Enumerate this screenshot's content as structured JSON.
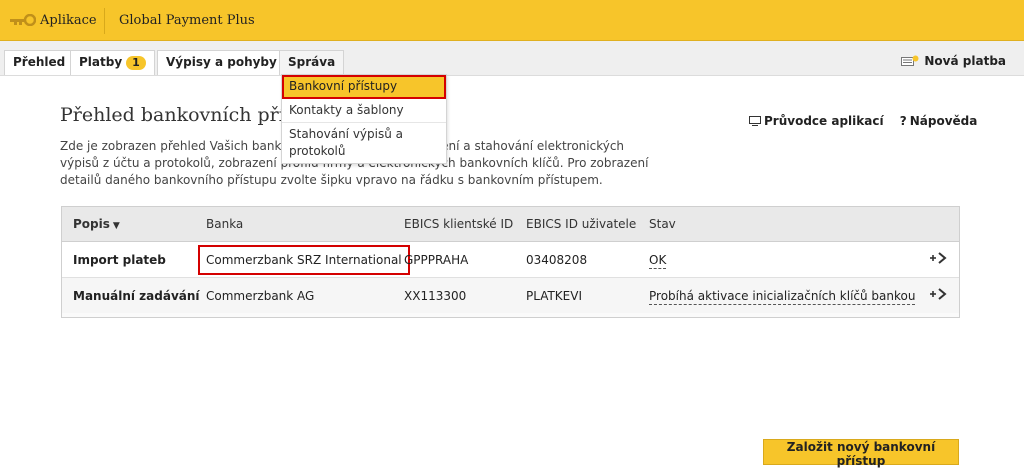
{
  "topbar": {
    "app_menu": "Aplikace",
    "product": "Global Payment Plus"
  },
  "nav": {
    "tabs": [
      {
        "label": "Přehled"
      },
      {
        "label": "Platby",
        "badge": "1"
      },
      {
        "label": "Výpisy a pohyby"
      },
      {
        "label": "Správa",
        "active": true
      }
    ],
    "new_payment": "Nová platba"
  },
  "dropdown": {
    "items": [
      {
        "label": "Bankovní přístupy",
        "selected": true
      },
      {
        "label": "Kontakty a šablony"
      },
      {
        "label": "Stahování výpisů a protokolů"
      }
    ]
  },
  "page": {
    "title": "Přehled bankovních přístupů",
    "description": "Zde je zobrazen přehled Vašich bankovních přístupů pro zobrazení a stahování elektronických výpisů z účtu a protokolů, zobrazení profilu firmy a elektronických bankovních klíčů. Pro zobrazení detailů daného bankovního přístupu zvolte šipku vpravo na řádku s bankovním přístupem.",
    "help_guide": "Průvodce aplikací",
    "help": "Nápověda"
  },
  "table": {
    "headers": [
      "Popis",
      "Banka",
      "EBICS klientské ID",
      "EBICS ID uživatele",
      "Stav"
    ],
    "rows": [
      {
        "popis": "Import plateb",
        "banka": "Commerzbank SRZ International",
        "client_id": "GPPPRAHA",
        "user_id": "03408208",
        "stav": "OK"
      },
      {
        "popis": "Manuální zadávání",
        "banka": "Commerzbank AG",
        "client_id": "XX113300",
        "user_id": "PLATKEVI",
        "stav": "Probíhá aktivace inicializačních klíčů bankou"
      }
    ]
  },
  "actions": {
    "create": "Založit nový bankovní přístup"
  },
  "colors": {
    "brand_yellow": "#f7c52a",
    "highlight_red": "#d40000"
  }
}
